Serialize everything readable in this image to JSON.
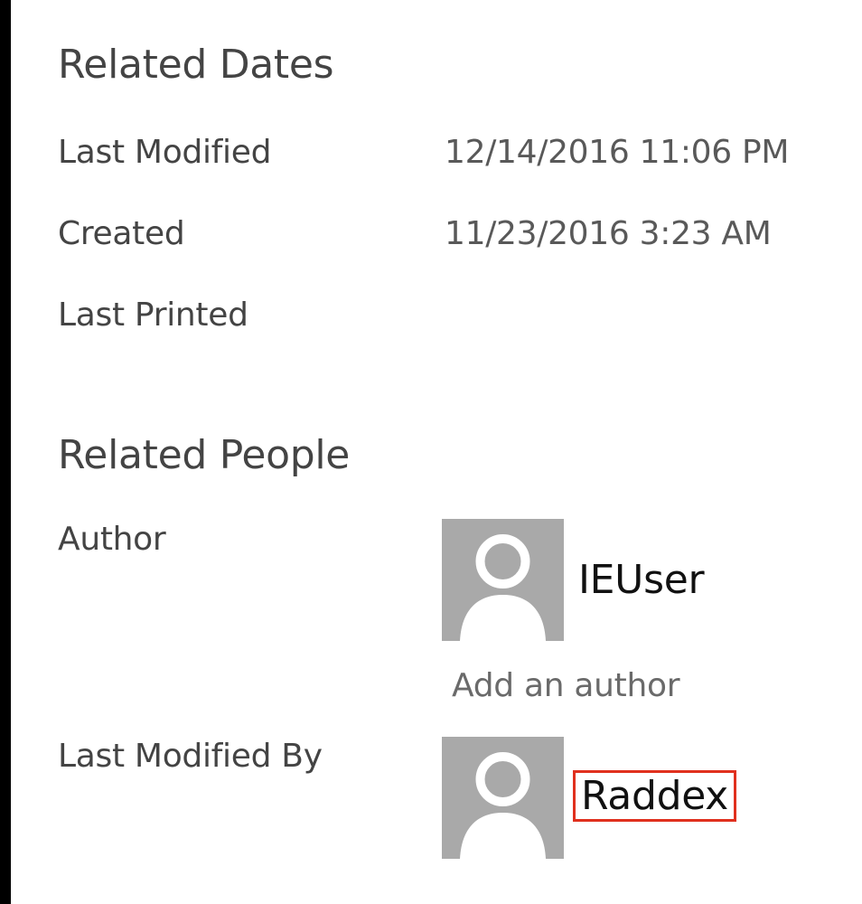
{
  "colors": {
    "avatar_background": "#a9a9a9",
    "avatar_silhouette": "#ffffff",
    "highlight_border": "#e0301e"
  },
  "related_dates": {
    "heading": "Related Dates",
    "last_modified_label": "Last Modified",
    "last_modified_value": "12/14/2016 11:06 PM",
    "created_label": "Created",
    "created_value": "11/23/2016 3:23 AM",
    "last_printed_label": "Last Printed"
  },
  "related_people": {
    "heading": "Related People",
    "author_label": "Author",
    "author_name": "IEUser",
    "author_avatar_icon": "person-icon",
    "add_author_link": "Add an author",
    "last_modified_by_label": "Last Modified By",
    "last_modified_by_name": "Raddex",
    "last_modified_by_avatar_icon": "person-icon"
  }
}
